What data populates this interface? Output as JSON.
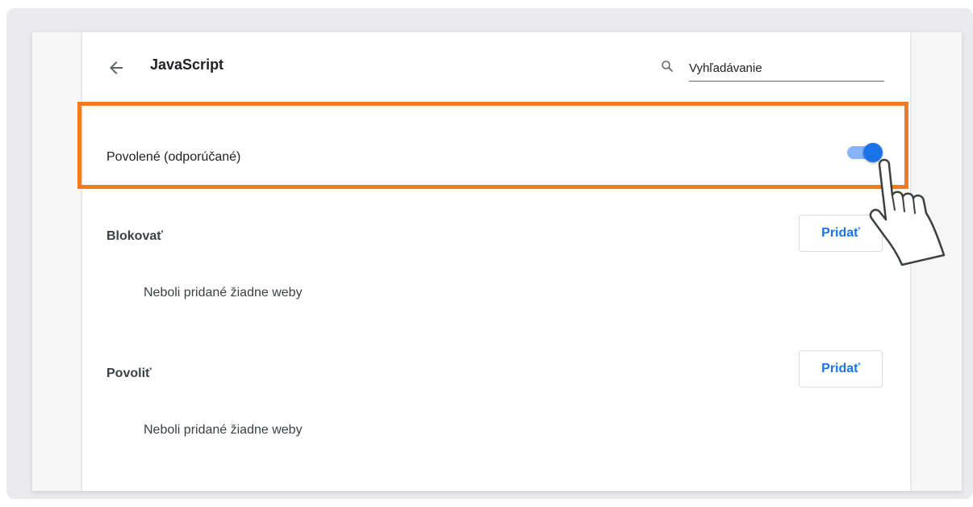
{
  "header": {
    "title": "JavaScript",
    "search_placeholder": "Vyhľadávanie",
    "back_icon": "arrow-left-icon",
    "search_icon": "magnifier-icon"
  },
  "allowed_row": {
    "label": "Povolené (odporúčané)",
    "toggle_on": true
  },
  "block_section": {
    "label": "Blokovať",
    "add_button": "Pridať",
    "empty_text": "Neboli pridané žiadne weby"
  },
  "allow_section": {
    "label": "Povoliť",
    "add_button": "Pridať",
    "empty_text": "Neboli pridané žiadne weby"
  },
  "colors": {
    "accent": "#1a73e8",
    "toggle_track": "#8ab4f8",
    "highlight": "#f47b20"
  }
}
